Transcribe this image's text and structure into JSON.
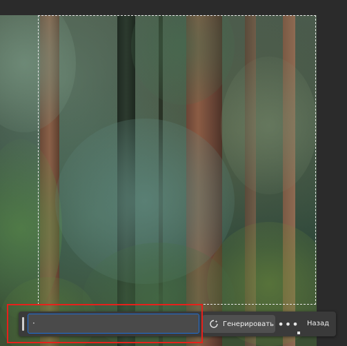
{
  "taskbar": {
    "prompt_value": "·",
    "generate_label": "Генерировать",
    "more_label": "•••",
    "back_label": "Назад",
    "accent": "#1f6fd6"
  },
  "annotation": {
    "highlight_color": "#e8201b"
  },
  "icons": {
    "generate": "generate-sparkle-icon",
    "more": "more-options-icon"
  }
}
